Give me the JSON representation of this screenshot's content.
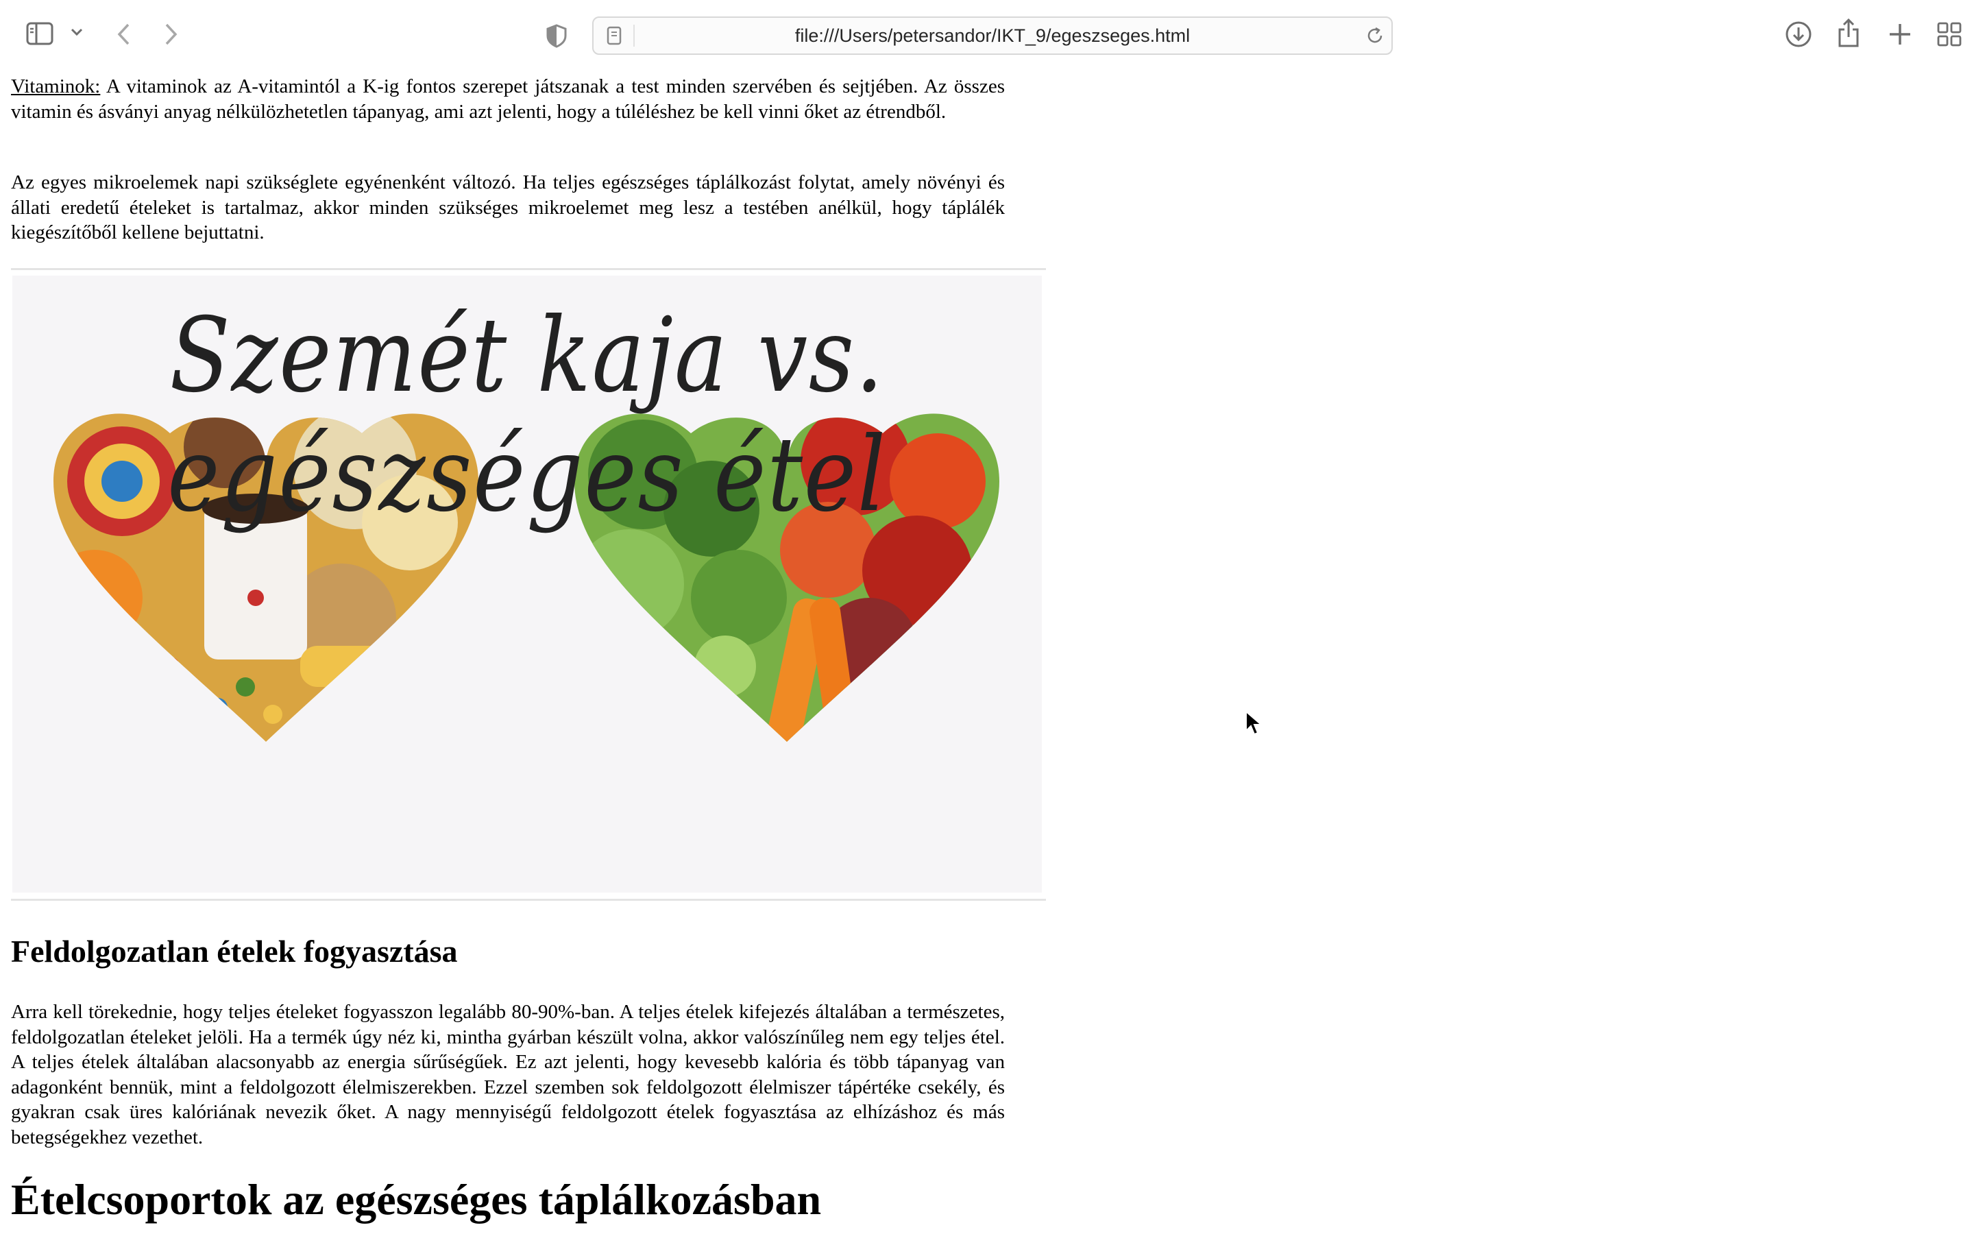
{
  "browser": {
    "url": "file:///Users/petersandor/IKT_9/egeszseges.html",
    "icons": {
      "sidebar": "sidebar-icon",
      "sidebar_menu": "chevron-down-icon",
      "back": "chevron-left-icon",
      "forward": "chevron-right-icon",
      "privacy": "shield-half-icon",
      "page": "page-icon",
      "reload": "reload-icon",
      "download": "download-icon",
      "share": "share-icon",
      "new_tab": "plus-icon",
      "tab_overview": "grid-icon"
    }
  },
  "content": {
    "vitamins_label": "Vitaminok:",
    "vitamins_text": " A vitaminok az A-vitamintól a K-ig fontos szerepet játszanak a test minden szervében és sejtjében. Az összes vitamin és ásványi anyag nélkülözhetetlen tápanyag, ami azt jelenti, hogy a túléléshez be kell vinni őket az étrendből.",
    "micro_text": "Az egyes mikroelemek napi szükséglete egyénenként változó. Ha teljes egészséges táplálkozást folytat, amely növényi és állati eredetű ételeket is tartalmaz, akkor minden szükséges mikroelemet meg lesz a testében anélkül, hogy táplálék kiegészítőből kellene bejuttatni.",
    "image_headline": "Szemét kaja vs. egészséges étel",
    "section_heading": "Feldolgozatlan ételek fogyasztása",
    "section_text": "Arra kell törekednie, hogy teljes ételeket fogyasszon legalább 80-90%-ban. A teljes ételek kifejezés általában a természetes, feldolgozatlan ételeket jelöli. Ha a termék úgy néz ki, mintha gyárban készült volna, akkor valószínűleg nem egy teljes étel. A teljes ételek általában alacsonyabb az energia sűrűségűek. Ez azt jelenti, hogy kevesebb kalória és több tápanyag van adagonként bennük, mint a feldolgozott élelmiszerekben. Ezzel szemben sok feldolgozott élelmiszer tápértéke csekély, és gyakran csak üres kalóriának nevezik őket. A nagy mennyiségű feldolgozott ételek fogyasztása az elhízáshoz és más betegségekhez vezethet.",
    "main_heading": "Ételcsoportok az egészséges táplálkozásban"
  },
  "colors": {
    "junk_palette": [
      "#d9a441",
      "#c0602c",
      "#f0c24a",
      "#7a4a2a",
      "#e8d9b0",
      "#c8302d"
    ],
    "healthy_palette": [
      "#4c8a2f",
      "#79b046",
      "#c72a1f",
      "#e24a1e",
      "#f08a24",
      "#8c2a2a"
    ]
  }
}
